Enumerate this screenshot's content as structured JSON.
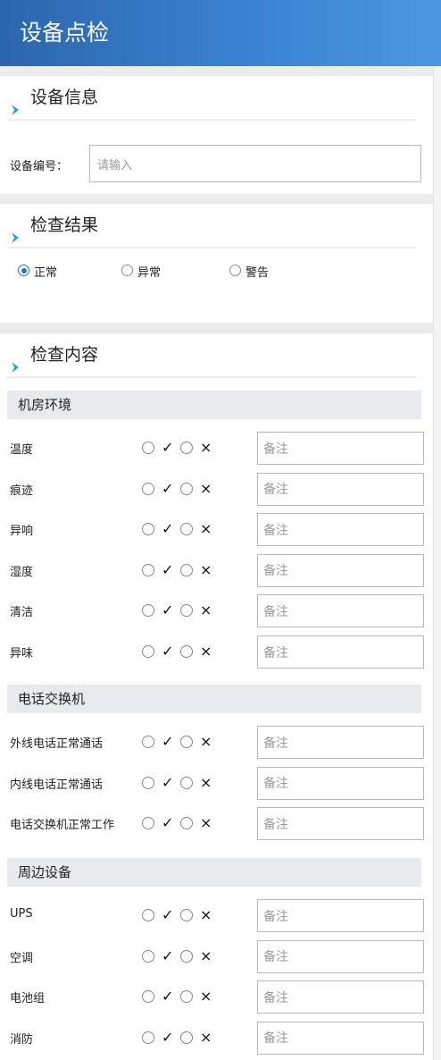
{
  "header": {
    "title": "设备点检"
  },
  "sections": {
    "device_info": "设备信息",
    "result": "检查结果",
    "content": "检查内容"
  },
  "device": {
    "label": "设备编号：",
    "placeholder": "请输入"
  },
  "result_options": [
    {
      "label": "正常",
      "selected": true
    },
    {
      "label": "异常",
      "selected": false
    },
    {
      "label": "警告",
      "selected": false
    }
  ],
  "marks": {
    "ok": "✓",
    "bad": "×"
  },
  "note_placeholder": "备注",
  "categories": [
    {
      "name": "机房环境",
      "items": [
        "温度",
        "痕迹",
        "异响",
        "湿度",
        "清洁",
        "异味"
      ]
    },
    {
      "name": "电话交换机",
      "items": [
        "外线电话正常通话",
        "内线电话正常通话",
        "电话交换机正常工作"
      ]
    },
    {
      "name": "周边设备",
      "items": [
        "UPS",
        "空调",
        "电池组",
        "消防"
      ]
    }
  ],
  "colors": {
    "header_start": "#2c66ad",
    "header_end": "#4a97e0",
    "accent": "#2f6fd0",
    "arrow": "#2aa2e0"
  }
}
